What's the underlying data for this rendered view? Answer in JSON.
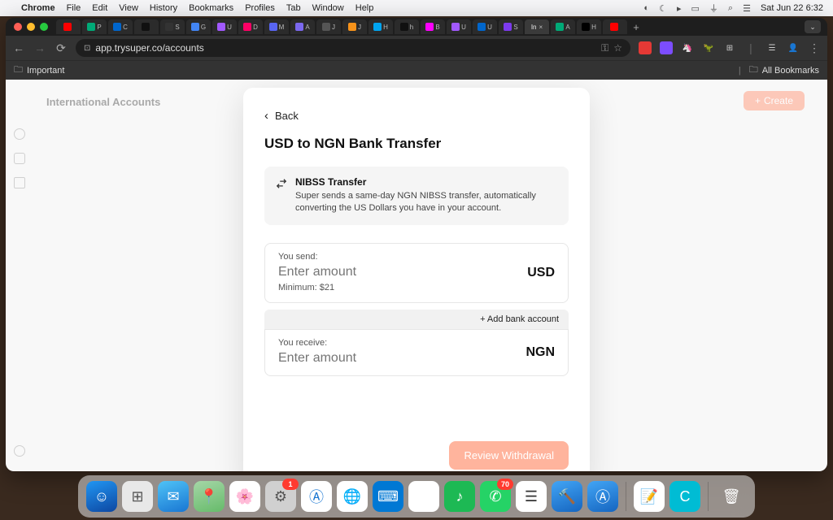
{
  "menubar": {
    "app": "Chrome",
    "items": [
      "File",
      "Edit",
      "View",
      "History",
      "Bookmarks",
      "Profiles",
      "Tab",
      "Window",
      "Help"
    ],
    "clock": "Sat Jun 22  6:32"
  },
  "browser": {
    "url": "app.trysuper.co/accounts",
    "bookmarks": {
      "important": "Important",
      "all": "All Bookmarks"
    }
  },
  "page": {
    "bg_title": "International Accounts",
    "create_btn": "Create"
  },
  "modal": {
    "back": "Back",
    "title": "USD to NGN Bank Transfer",
    "info": {
      "title": "NIBSS Transfer",
      "desc": "Super sends a same-day NGN NIBSS transfer, automatically converting the US Dollars you have in your account."
    },
    "send": {
      "label": "You send:",
      "placeholder": "Enter amount",
      "currency": "USD",
      "minimum": "Minimum: $21"
    },
    "add_bank": "+ Add bank account",
    "receive": {
      "label": "You receive:",
      "placeholder": "Enter amount",
      "currency": "NGN"
    },
    "review_btn": "Review Withdrawal"
  },
  "tabs": [
    "",
    "P",
    "C",
    "",
    "S",
    "G",
    "U",
    "D",
    "M",
    "A",
    "J",
    "J",
    "H",
    "h",
    "B",
    "U",
    "U",
    "S",
    "In",
    "A",
    "H",
    ""
  ]
}
